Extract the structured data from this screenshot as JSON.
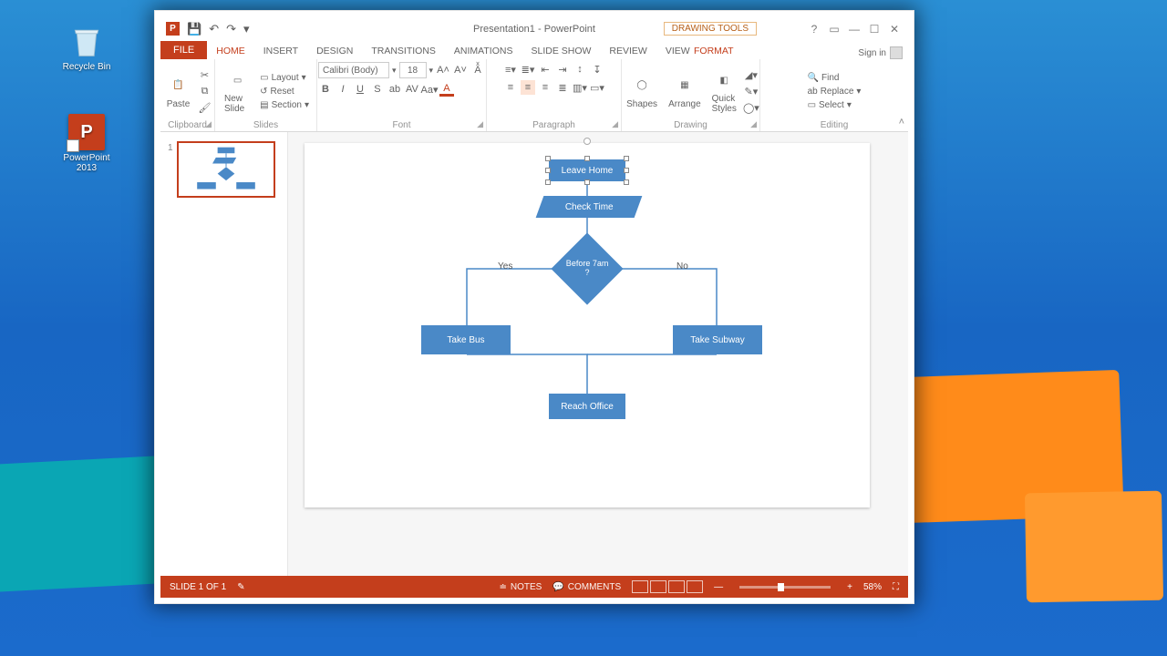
{
  "desktop": {
    "recycle_bin": "Recycle Bin",
    "powerpoint": "PowerPoint 2013"
  },
  "window": {
    "title": "Presentation1 - PowerPoint",
    "context_tab": "DRAWING TOOLS",
    "signin": "Sign in"
  },
  "tabs": {
    "file": "FILE",
    "home": "HOME",
    "insert": "INSERT",
    "design": "DESIGN",
    "transitions": "TRANSITIONS",
    "animations": "ANIMATIONS",
    "slideshow": "SLIDE SHOW",
    "review": "REVIEW",
    "view": "VIEW",
    "format": "FORMAT"
  },
  "ribbon": {
    "clipboard": {
      "label": "Clipboard",
      "paste": "Paste"
    },
    "slides": {
      "label": "Slides",
      "new_slide": "New Slide",
      "layout": "Layout",
      "reset": "Reset",
      "section": "Section"
    },
    "font": {
      "label": "Font",
      "name": "Calibri (Body)",
      "size": "18"
    },
    "paragraph": {
      "label": "Paragraph"
    },
    "drawing": {
      "label": "Drawing",
      "shapes": "Shapes",
      "arrange": "Arrange",
      "quick_styles": "Quick Styles"
    },
    "editing": {
      "label": "Editing",
      "find": "Find",
      "replace": "Replace",
      "select": "Select"
    }
  },
  "thumbnail": {
    "index": "1"
  },
  "flow": {
    "leave_home": "Leave Home",
    "check_time": "Check Time",
    "decision": "Before 7am ?",
    "yes": "Yes",
    "no": "No",
    "take_bus": "Take Bus",
    "take_subway": "Take Subway",
    "reach_office": "Reach Office"
  },
  "status": {
    "slide": "SLIDE 1 OF 1",
    "notes": "NOTES",
    "comments": "COMMENTS",
    "zoom": "58%"
  },
  "chart_data": {
    "type": "flowchart",
    "nodes": [
      {
        "id": "start",
        "type": "process",
        "label": "Leave Home"
      },
      {
        "id": "check",
        "type": "data",
        "label": "Check Time"
      },
      {
        "id": "dec",
        "type": "decision",
        "label": "Before 7am ?"
      },
      {
        "id": "bus",
        "type": "process",
        "label": "Take Bus"
      },
      {
        "id": "sub",
        "type": "process",
        "label": "Take Subway"
      },
      {
        "id": "end",
        "type": "process",
        "label": "Reach Office"
      }
    ],
    "edges": [
      {
        "from": "start",
        "to": "check"
      },
      {
        "from": "check",
        "to": "dec"
      },
      {
        "from": "dec",
        "to": "bus",
        "label": "Yes"
      },
      {
        "from": "dec",
        "to": "sub",
        "label": "No"
      },
      {
        "from": "bus",
        "to": "end"
      },
      {
        "from": "sub",
        "to": "end"
      }
    ]
  }
}
